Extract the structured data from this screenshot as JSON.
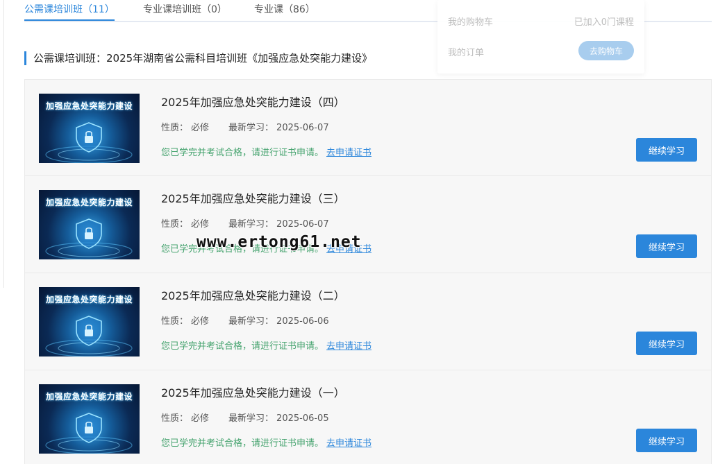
{
  "tabs": [
    {
      "label": "公需课培训班（11）",
      "active": true
    },
    {
      "label": "专业课培训班（0）",
      "active": false
    },
    {
      "label": "专业课（86）",
      "active": false
    }
  ],
  "section_title": "公需课培训班：2025年湖南省公需科目培训班《加强应急处突能力建设》",
  "courses": [
    {
      "thumb_title": "加强应急处突能力建设",
      "title": "2025年加强应急处突能力建设（四）",
      "nature_label": "性质：",
      "nature": "必修",
      "latest_label": "最新学习：",
      "latest": "2025-06-07",
      "status": "您已学完并考试合格，请进行证书申请。",
      "status_link": "去申请证书",
      "button": "继续学习"
    },
    {
      "thumb_title": "加强应急处突能力建设",
      "title": "2025年加强应急处突能力建设（三）",
      "nature_label": "性质：",
      "nature": "必修",
      "latest_label": "最新学习：",
      "latest": "2025-06-07",
      "status": "您已学完并考试合格，请进行证书申请。",
      "status_link": "去申请证书",
      "button": "继续学习"
    },
    {
      "thumb_title": "加强应急处突能力建设",
      "title": "2025年加强应急处突能力建设（二）",
      "nature_label": "性质：",
      "nature": "必修",
      "latest_label": "最新学习：",
      "latest": "2025-06-06",
      "status": "您已学完并考试合格，请进行证书申请。",
      "status_link": "去申请证书",
      "button": "继续学习"
    },
    {
      "thumb_title": "加强应急处突能力建设",
      "title": "2025年加强应急处突能力建设（一）",
      "nature_label": "性质：",
      "nature": "必修",
      "latest_label": "最新学习：",
      "latest": "2025-06-05",
      "status": "您已学完并考试合格，请进行证书申请。",
      "status_link": "去申请证书",
      "button": "继续学习"
    }
  ],
  "cart_popup": {
    "my_cart": "我的购物车",
    "cart_count": "已加入0门课程",
    "my_orders": "我的订单",
    "go_cart_button": "去购物车"
  },
  "watermark": "www.ertong61.net",
  "colors": {
    "accent": "#2b86db",
    "success": "#45a36e",
    "item_bg": "#f7f7f7"
  }
}
